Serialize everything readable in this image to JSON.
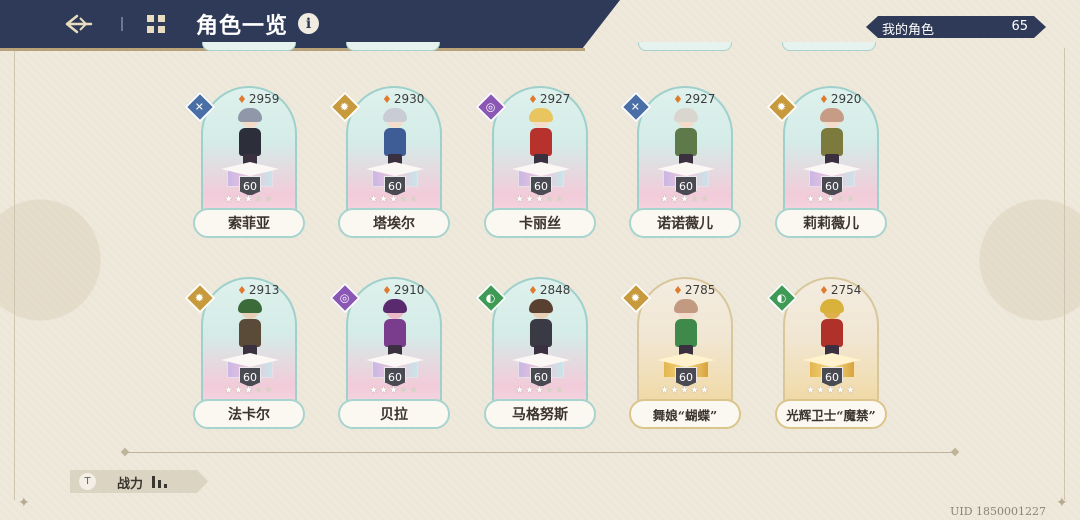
{
  "header": {
    "title": "角色一览",
    "my_characters_label": "我的角色",
    "my_characters_count": "65"
  },
  "characters": [
    {
      "name": "索菲亚",
      "power": "2959",
      "level": "60",
      "stars": 3,
      "element": "wind",
      "theme": "normal",
      "hair": "#8f97a8",
      "body": "#2c2f3a",
      "skin": "#f4dccb"
    },
    {
      "name": "塔埃尔",
      "power": "2930",
      "level": "60",
      "stars": 3,
      "element": "light",
      "theme": "normal",
      "hair": "#c9ccd4",
      "body": "#3e5d97",
      "skin": "#f4dccb"
    },
    {
      "name": "卡丽丝",
      "power": "2927",
      "level": "60",
      "stars": 3,
      "element": "dark",
      "theme": "normal",
      "hair": "#e8c55e",
      "body": "#b8322d",
      "skin": "#f4dccb"
    },
    {
      "name": "诺诺薇儿",
      "power": "2927",
      "level": "60",
      "stars": 3,
      "element": "wind",
      "theme": "normal",
      "hair": "#d9d5cf",
      "body": "#5e7a4a",
      "skin": "#f4dccb"
    },
    {
      "name": "莉莉薇儿",
      "power": "2920",
      "level": "60",
      "stars": 3,
      "element": "light",
      "theme": "normal",
      "hair": "#c79c86",
      "body": "#7c7a3c",
      "skin": "#f4dccb"
    },
    {
      "name": "法卡尔",
      "power": "2913",
      "level": "60",
      "stars": 3,
      "element": "light",
      "theme": "normal",
      "hair": "#3c6b3a",
      "body": "#5a4a38",
      "skin": "#e8cfb8"
    },
    {
      "name": "贝拉",
      "power": "2910",
      "level": "60",
      "stars": 3,
      "element": "dark",
      "theme": "normal",
      "hair": "#5a2a6e",
      "body": "#7a3c8c",
      "skin": "#e9b9c8"
    },
    {
      "name": "马格努斯",
      "power": "2848",
      "level": "60",
      "stars": 3,
      "element": "earth",
      "theme": "normal",
      "hair": "#5a4030",
      "body": "#3a3a44",
      "skin": "#e8cfb8"
    },
    {
      "name": "舞娘“蝴蝶”",
      "power": "2785",
      "level": "60",
      "stars": 5,
      "element": "light",
      "theme": "gold",
      "hair": "#c29a82",
      "body": "#3f8a4a",
      "skin": "#f4dccb"
    },
    {
      "name": "光辉卫士“魔禁”",
      "power": "2754",
      "level": "60",
      "stars": 5,
      "element": "earth",
      "theme": "gold",
      "hair": "#d9b23c",
      "body": "#b0302a",
      "skin": "#e0b04a"
    }
  ],
  "footer": {
    "sort_label": "战力",
    "sort_icon_text": "T",
    "uid": "UID 1850001227"
  },
  "colors": {
    "header_bg": "#2e3a57",
    "page_bg": "#efe9dc",
    "flame": "#e07a2f"
  }
}
